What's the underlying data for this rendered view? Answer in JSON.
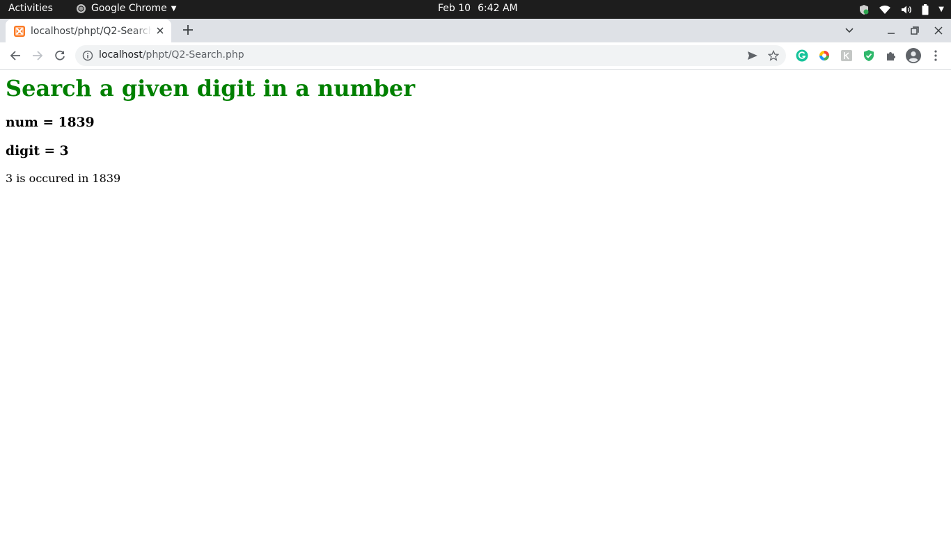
{
  "topbar": {
    "activities": "Activities",
    "app_name": "Google Chrome",
    "date": "Feb 10",
    "time": "6:42 AM"
  },
  "tab": {
    "title": "localhost/phpt/Q2-Search.php",
    "favicon": "xampp-icon"
  },
  "address_bar": {
    "host": "localhost",
    "path": "/phpt/Q2-Search.php"
  },
  "extensions": [
    "grammarly-icon",
    "color-wheel-icon",
    "keyword-extension-icon",
    "shield-check-icon",
    "puzzle-icon",
    "profile-avatar-icon"
  ],
  "page": {
    "heading": "Search a given digit in a number",
    "num_line": "num = 1839",
    "digit_line": "digit = 3",
    "result": "3 is occured in 1839"
  },
  "colors": {
    "heading": "#008000",
    "topbar_bg": "#1d1d1d",
    "tabstrip_bg": "#dee1e6"
  }
}
